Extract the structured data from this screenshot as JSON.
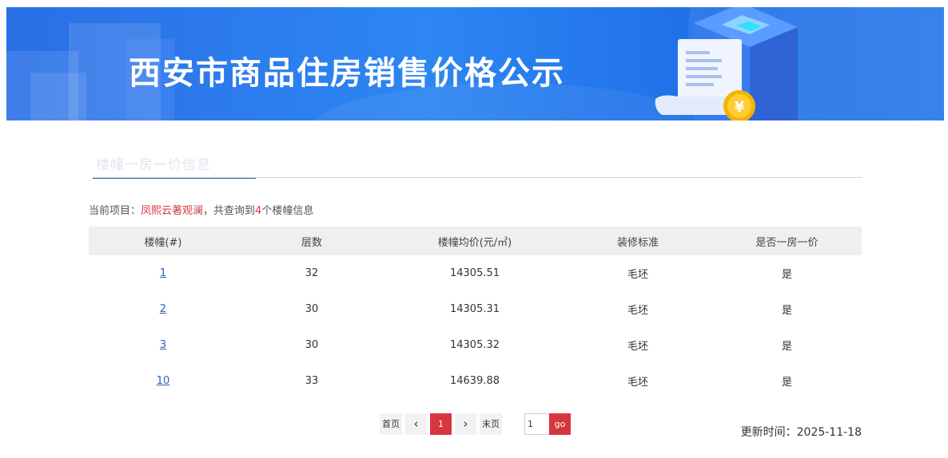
{
  "banner": {
    "title": "西安市商品住房销售价格公示",
    "colors": {
      "primary": "#2a78ea",
      "accent_coin": "#f5b300"
    },
    "icons": [
      "document-icon",
      "coin-icon",
      "building-icon"
    ]
  },
  "tab": {
    "label": "楼幢一房一价信息"
  },
  "summary": {
    "prefix": "当前项目：",
    "project": "凤熙云著观澜",
    "mid": "，共查询到",
    "count": "4",
    "suffix": "个楼幢信息"
  },
  "table": {
    "headers": [
      "楼幢(#)",
      "层数",
      "楼幢均价(元/㎡)",
      "装修标准",
      "是否一房一价"
    ],
    "rows": [
      {
        "building": "1",
        "floors": "32",
        "avg_price": "14305.51",
        "decoration": "毛坯",
        "one_price": "是"
      },
      {
        "building": "2",
        "floors": "30",
        "avg_price": "14305.31",
        "decoration": "毛坯",
        "one_price": "是"
      },
      {
        "building": "3",
        "floors": "30",
        "avg_price": "14305.32",
        "decoration": "毛坯",
        "one_price": "是"
      },
      {
        "building": "10",
        "floors": "33",
        "avg_price": "14639.88",
        "decoration": "毛坯",
        "one_price": "是"
      }
    ]
  },
  "pagination": {
    "first": "首页",
    "prev": "‹",
    "current": "1",
    "next": "›",
    "last": "末页",
    "input_value": "1",
    "go": "go"
  },
  "update": {
    "label": "更新时间：",
    "date": "2025-11-18"
  }
}
